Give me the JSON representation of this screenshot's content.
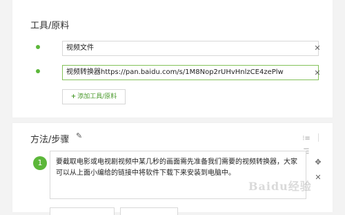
{
  "tools": {
    "title": "工具/原料",
    "items": [
      {
        "value": "视频文件"
      },
      {
        "value": "视频转换器https://pan.baidu.com/s/1M8Nop2rUHvHnlzCE4zePlw"
      }
    ],
    "add_label": "添加工具/原料",
    "add_plus": "+"
  },
  "method": {
    "title": "方法/步骤",
    "steps": [
      {
        "number": "1",
        "text": "要截取电影或电视剧视频中某几秒的画面需先准备我们需要的视频转换器，大家可以从上面小编给的链接中将软件下载下来安装到电脑中。"
      }
    ]
  },
  "watermark": "Baidu经验",
  "colors": {
    "accent": "#5cb73a"
  },
  "icons": [
    "edit-icon",
    "close-icon",
    "list-view-icon",
    "grid-view-icon",
    "move-icon",
    "plus-icon"
  ]
}
